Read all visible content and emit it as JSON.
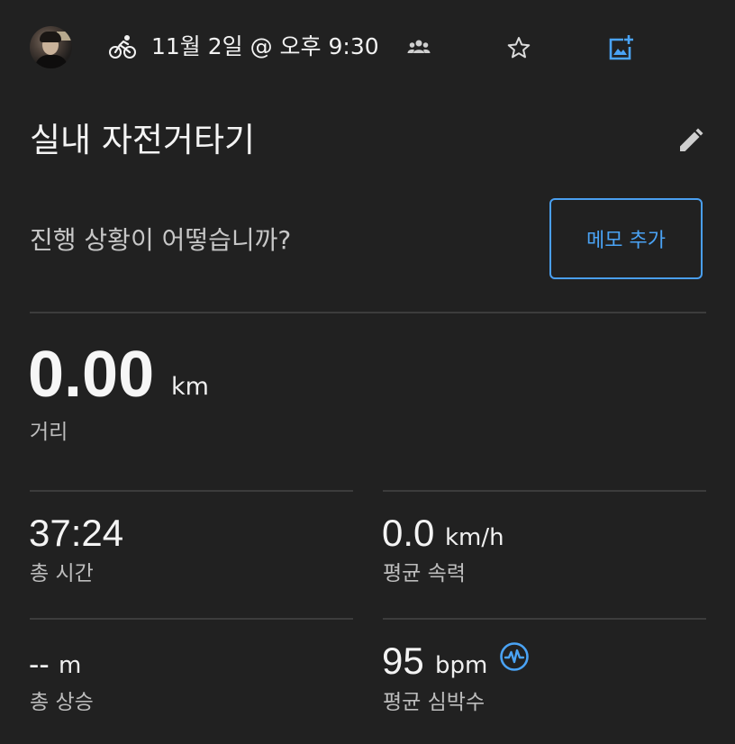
{
  "header": {
    "activity_icon": "cycling-icon",
    "datetime": "11월 2일 @ 오후 9:30",
    "icons": [
      "group-icon",
      "star-icon",
      "add-photo-icon"
    ],
    "accent_color": "#4aa3f5"
  },
  "activity": {
    "title": "실내 자전거타기",
    "edit_icon": "pencil-icon"
  },
  "note": {
    "prompt": "진행 상황이 어떻습니까?",
    "add_memo_label": "메모 추가"
  },
  "distance": {
    "value": "0.00",
    "unit": "km",
    "label": "거리"
  },
  "stats": {
    "total_time": {
      "value": "37:24",
      "label": "총 시간"
    },
    "avg_speed": {
      "value": "0.0",
      "unit": "km/h",
      "label": "평균 속력"
    },
    "total_ascent": {
      "value": "--",
      "unit": "m",
      "label": "총 상승"
    },
    "avg_hr": {
      "value": "95",
      "unit": "bpm",
      "label": "평균 심박수",
      "icon": "heart-rate-icon"
    }
  }
}
